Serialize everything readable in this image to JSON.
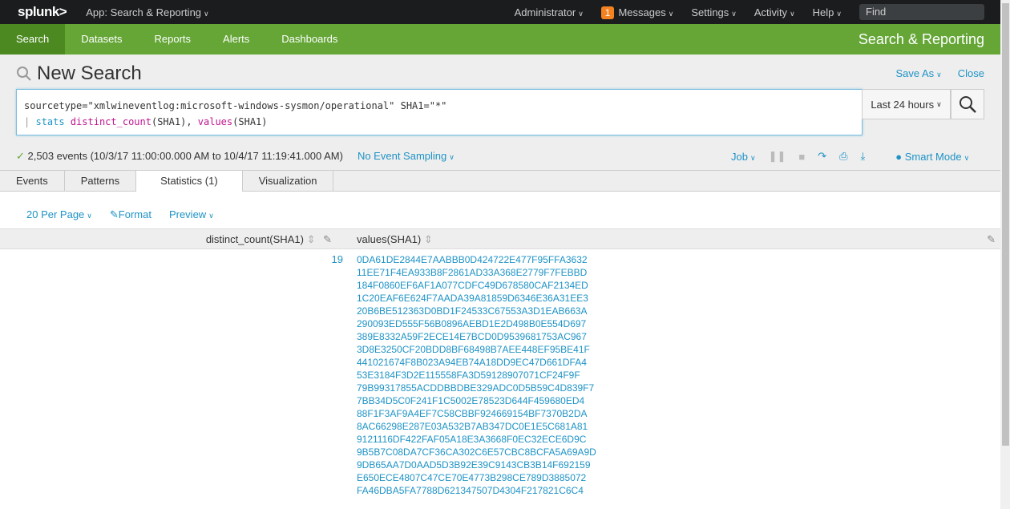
{
  "topbar": {
    "logo": "splunk>",
    "app": "App: Search & Reporting",
    "admin": "Administrator",
    "messages_count": "1",
    "messages": "Messages",
    "settings": "Settings",
    "activity": "Activity",
    "help": "Help",
    "find_placeholder": "Find"
  },
  "nav": {
    "items": [
      "Search",
      "Datasets",
      "Reports",
      "Alerts",
      "Dashboards"
    ],
    "app_title": "Search & Reporting"
  },
  "header": {
    "title": "New Search",
    "save_as": "Save As",
    "close": "Close"
  },
  "query": {
    "line1": "sourcetype=\"xmlwineventlog:microsoft-windows-sysmon/operational\" SHA1=\"*\"",
    "pipe": "|",
    "cmd": "stats",
    "fn1": "distinct_count",
    "arg1": "(SHA1), ",
    "fn2": "values",
    "arg2": "(SHA1)"
  },
  "time_picker": "Last 24 hours",
  "status": {
    "events": "2,503 events (10/3/17 11:00:00.000 AM to 10/4/17 11:19:41.000 AM)",
    "sampling": "No Event Sampling",
    "job": "Job",
    "mode": "Smart Mode"
  },
  "tabs": [
    "Events",
    "Patterns",
    "Statistics (1)",
    "Visualization"
  ],
  "options": {
    "per_page": "20 Per Page",
    "format": "Format",
    "preview": "Preview"
  },
  "table": {
    "columns": [
      "distinct_count(SHA1)",
      "values(SHA1)"
    ],
    "count": "19",
    "values": [
      "0DA61DE2844E7AABBB0D424722E477F95FFA3632",
      "11EE71F4EA933B8F2861AD33A368E2779F7FEBBD",
      "184F0860EF6AF1A077CDFC49D678580CAF2134ED",
      "1C20EAF6E624F7AADA39A81859D6346E36A31EE3",
      "20B6BE512363D0BD1F24533C67553A3D1EAB663A",
      "290093ED555F56B0896AEBD1E2D498B0E554D697",
      "389E8332A59F2ECE14E7BCD0D9539681753AC967",
      "3D8E3250CF20BDD8BF68498B7AEE448EF95BE41F",
      "441021674F8B023A94EB74A18DD9EC47D661DFA4",
      "53E3184F3D2E115558FA3D59128907071CF24F9F",
      "79B99317855ACDDBBDBE329ADC0D5B59C4D839F7",
      "7BB34D5C0F241F1C5002E78523D644F459680ED4",
      "88F1F3AF9A4EF7C58CBBF924669154BF7370B2DA",
      "8AC66298E287E03A532B7AB347DC0E1E5C681A81",
      "9121116DF422FAF05A18E3A3668F0EC32ECE6D9C",
      "9B5B7C08DA7CF36CA302C6E57CBC8BCFA5A69A9D",
      "9DB65AA7D0AAD5D3B92E39C9143CB3B14F692159",
      "E650ECE4807C47CE70E4773B298CE789D3885072",
      "FA46DBA5FA7788D621347507D4304F217821C6C4"
    ]
  }
}
